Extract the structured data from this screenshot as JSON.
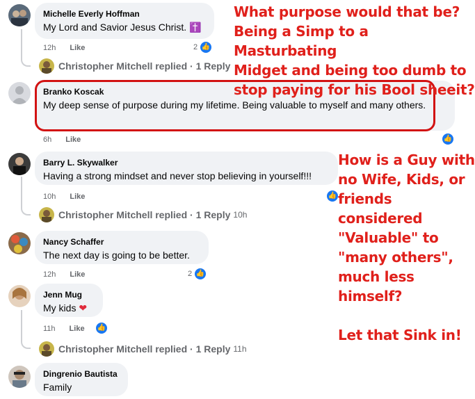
{
  "comments": [
    {
      "name": "Michelle Everly Hoffman",
      "text": "My Lord and Savior Jesus Christ. ✝️",
      "time": "12h",
      "like": "Like",
      "reactions": "2",
      "reply": "Christopher Mitchell replied · 1 Reply",
      "reply_time": ""
    },
    {
      "name": "Branko Koscak",
      "text": "My deep sense of purpose during my lifetime. Being valuable to myself and many others.",
      "time": "6h",
      "like": "Like"
    },
    {
      "name": "Barry L. Skywalker",
      "text": "Having a strong mindset and never stop believing in yourself!!!",
      "time": "10h",
      "like": "Like",
      "reply": "Christopher Mitchell replied · 1 Reply",
      "reply_time": "10h"
    },
    {
      "name": "Nancy Schaffer",
      "text": "The next day is going to be better.",
      "time": "12h",
      "like": "Like",
      "reactions": "2"
    },
    {
      "name": "Jenn Mug",
      "text": "My kids",
      "time": "11h",
      "like": "Like",
      "reply": "Christopher Mitchell replied · 1 Reply",
      "reply_time": "11h"
    },
    {
      "name": "Dingrenio Bautista",
      "text": "Family"
    }
  ],
  "annotations": {
    "top": [
      "What purpose would that be?",
      "Being a Simp to a Masturbating",
      "Midget and being too dumb to",
      "stop paying for his Bool sheeit?"
    ],
    "side": [
      "How is a Guy with",
      "no Wife, Kids, or",
      "friends considered",
      "\"Valuable\" to",
      "\"many others\",",
      "much less himself?",
      "",
      "Let that Sink in!"
    ]
  },
  "colors": {
    "accent": "#1877f2",
    "annotation": "#e0201b",
    "bubble": "#f0f2f5"
  }
}
